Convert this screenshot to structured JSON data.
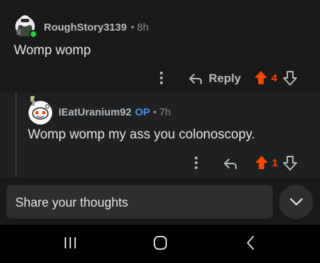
{
  "comments": [
    {
      "username": "RoughStory3139",
      "time": "8h",
      "body": "Womp womp",
      "reply_label": "Reply",
      "votes": "4"
    },
    {
      "username": "IEatUranium92",
      "op_badge": "OP",
      "time": "7h",
      "body": "Womp womp my ass you colonoscopy.",
      "votes": "1"
    }
  ],
  "composer": {
    "placeholder": "Share your thoughts"
  },
  "colors": {
    "upvote": "#ff4500",
    "op": "#4a8fe7",
    "background": "#1a1a1b"
  },
  "icons": [
    "more-options-icon",
    "reply-arrow-icon",
    "upvote-icon",
    "downvote-icon",
    "chevron-down-icon",
    "recent-apps-icon",
    "home-icon",
    "back-icon"
  ]
}
